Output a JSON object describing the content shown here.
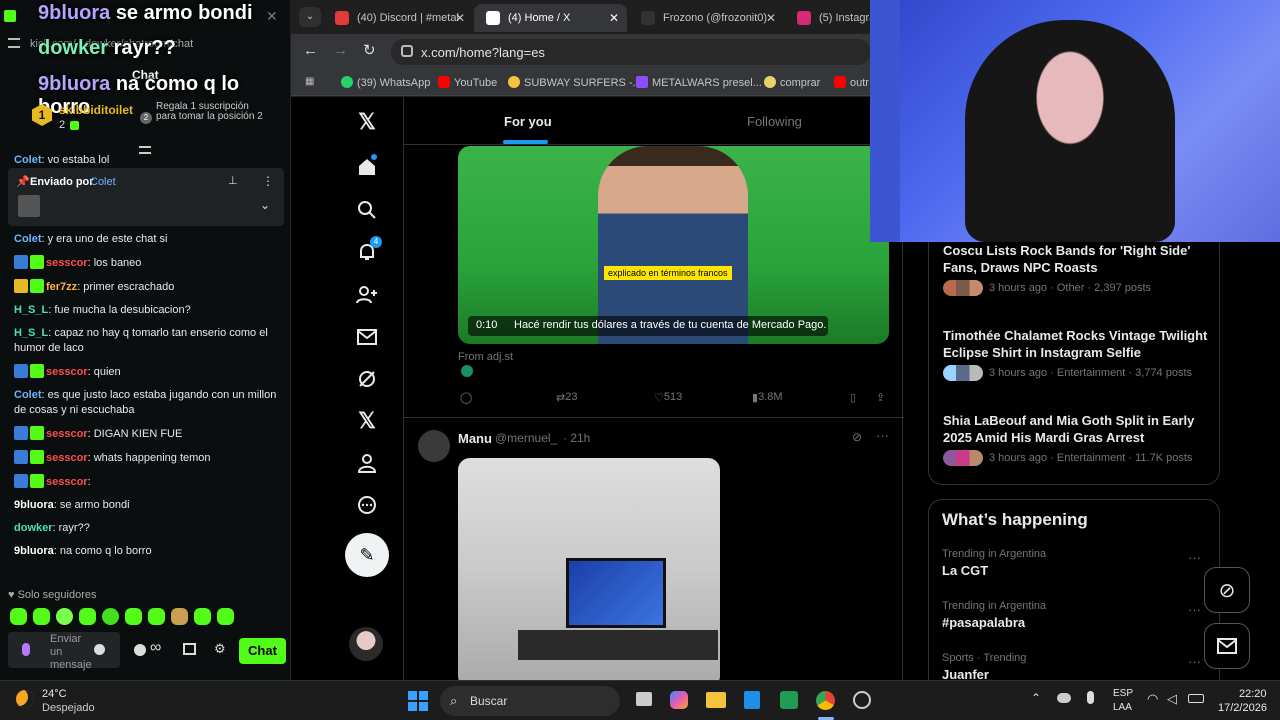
{
  "chat_panel": {
    "overlay_lines": [
      {
        "user": "9bluora",
        "text": "se armo bondi"
      },
      {
        "user": "dowker",
        "text": "rayr??"
      },
      {
        "user": "9bluora",
        "text": "na como q lo borro"
      }
    ],
    "url_fragment": "kick.com/...dowker/chatroom/chat",
    "chat_header": "Chat",
    "leader": {
      "rank": "1",
      "name": "skibbiditoilet",
      "count": "2",
      "promo_text": "Regala 1 suscripción para tomar la posición 2",
      "promo_rank": "2"
    },
    "pinned": {
      "label": "Enviado por",
      "user": "Colet"
    },
    "partial_message": {
      "user": "Colet",
      "text": ": vo estaba lol"
    },
    "messages": [
      {
        "user": "Colet",
        "text": ": y era uno de este chat si",
        "color": "blue"
      },
      {
        "user": "sesscor",
        "text": ": los baneo",
        "color": "red"
      },
      {
        "user": "fer7zz",
        "text": ": primer escrachado",
        "color": "orange"
      },
      {
        "user": "H_S_L",
        "text": ": fue mucha la desubicacion?",
        "color": "teal"
      },
      {
        "user": "H_S_L",
        "text": ": capaz no hay q tomarlo tan enserio como el humor de laco",
        "color": "teal"
      },
      {
        "user": "sesscor",
        "text": ": quien",
        "color": "red"
      },
      {
        "user": "Colet",
        "text": ": es que justo laco estaba jugando con un millon de cosas y ni escuchaba",
        "color": "blue"
      },
      {
        "user": "sesscor",
        "text": ": DIGAN KIEN FUE",
        "color": "red"
      },
      {
        "user": "sesscor",
        "text": ": whats happening temon",
        "color": "red"
      },
      {
        "user": "sesscor",
        "text": ":",
        "color": "red"
      },
      {
        "user": "9bluora",
        "text": ": se armo bondi",
        "color": "white"
      },
      {
        "user": "dowker",
        "text": ": rayr??",
        "color": "teal"
      },
      {
        "user": "9bluora",
        "text": ": na como q lo borro",
        "color": "white"
      }
    ],
    "followers_only": "Solo seguidores",
    "input_placeholder": "Enviar un mensaje",
    "chat_button": "Chat",
    "infinity": "∞"
  },
  "browser": {
    "tabs": [
      {
        "label": "(40) Discord | #metal",
        "icon_color": "#5865f2"
      },
      {
        "label": "(4) Home / X",
        "icon_color": "#000000"
      },
      {
        "label": "Frozono (@frozonit0)",
        "icon_color": "#111111"
      },
      {
        "label": "(5) Instagram",
        "icon_color": "#d62976"
      }
    ],
    "url": "x.com/home?lang=es",
    "bookmarks": [
      {
        "label": "(39) WhatsApp",
        "color": "#25d366"
      },
      {
        "label": "YouTube",
        "color": "#ff0000"
      },
      {
        "label": "SUBWAY SURFERS -...",
        "color": "#f5c542"
      },
      {
        "label": "METALWARS presel...",
        "color": "#8a4fff"
      },
      {
        "label": "comprar",
        "color": "#e8d36a"
      },
      {
        "label": "outr",
        "color": "#ff0000"
      }
    ]
  },
  "x": {
    "nav_badge": "4",
    "feed_tabs": {
      "active": "For you",
      "other": "Following"
    },
    "tweet1": {
      "caption_tag": "explicado en términos francos",
      "time": "0:10",
      "subtitle": "Hacé rendir tus dólares a través de tu cuenta de Mercado Pago.",
      "from": "From adj.st",
      "stats": {
        "retweets": "23",
        "likes": "513",
        "views": "3.8M"
      }
    },
    "tweet2": {
      "name": "Manu",
      "handle": "@mernuel_",
      "time": "· 21h"
    },
    "news": [
      {
        "title": "Coscu Lists Rock Bands for 'Right Side' Fans, Draws NPC Roasts",
        "meta": "3 hours ago · Other · 2,397 posts"
      },
      {
        "title": "Timothée Chalamet Rocks Vintage Twilight Eclipse Shirt in Instagram Selfie",
        "meta": "3 hours ago · Entertainment · 3,774 posts"
      },
      {
        "title": "Shia LaBeouf and Mia Goth Split in Early 2025 Amid His Mardi Gras Arrest",
        "meta": "3 hours ago · Entertainment · 11.7K posts"
      }
    ],
    "happening": {
      "title": "What’s happening",
      "trends": [
        {
          "category": "Trending in Argentina",
          "name": "La CGT"
        },
        {
          "category": "Trending in Argentina",
          "name": "#pasapalabra"
        },
        {
          "category": "Sports · Trending",
          "name": "Juanfer"
        }
      ]
    }
  },
  "taskbar": {
    "weather_temp": "24°C",
    "weather_desc": "Despejado",
    "search_placeholder": "Buscar",
    "lang1": "ESP",
    "lang2": "LAA",
    "time": "22:20",
    "date": "17/2/2026"
  }
}
